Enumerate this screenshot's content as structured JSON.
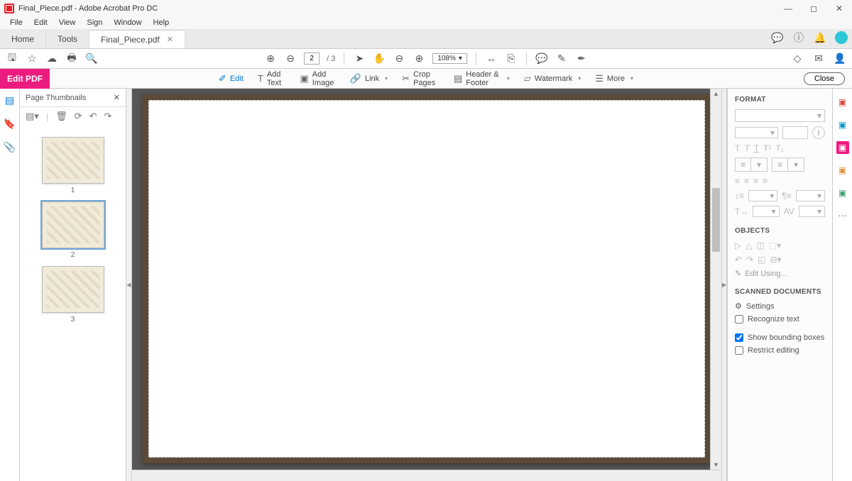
{
  "titlebar": {
    "filename": "Final_Piece.pdf",
    "app": "Adobe Acrobat Pro DC"
  },
  "menu": {
    "file": "File",
    "edit": "Edit",
    "view": "View",
    "sign": "Sign",
    "window": "Window",
    "help": "Help"
  },
  "tabs": {
    "home": "Home",
    "tools": "Tools",
    "file": "Final_Piece.pdf"
  },
  "toolbar": {
    "page_current": "2",
    "page_total": "/ 3",
    "zoom": "108%"
  },
  "editbar": {
    "title": "Edit PDF",
    "edit": "Edit",
    "addtext": "Add Text",
    "addimage": "Add Image",
    "link": "Link",
    "crop": "Crop Pages",
    "header": "Header & Footer",
    "watermark": "Watermark",
    "more": "More",
    "close": "Close"
  },
  "thumbpanel": {
    "title": "Page Thumbnails",
    "nums": [
      "1",
      "2",
      "3"
    ]
  },
  "format": {
    "title": "FORMAT",
    "objects": "OBJECTS",
    "edit_using": "Edit Using...",
    "scanned": "SCANNED DOCUMENTS",
    "settings": "Settings",
    "recognize": "Recognize text",
    "show_bb": "Show bounding boxes",
    "restrict": "Restrict editing"
  }
}
